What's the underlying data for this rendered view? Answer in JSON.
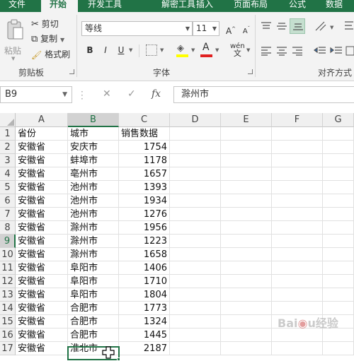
{
  "colors": {
    "accent": "#217346",
    "ribbon_bg": "#f3f3f3",
    "selection": "#217346"
  },
  "tabs": [
    {
      "label": "文件",
      "active": false
    },
    {
      "label": "开始",
      "active": true
    },
    {
      "label": "开发工具",
      "active": false
    },
    {
      "label": "解密工具",
      "active": false
    },
    {
      "label": "插入",
      "active": false
    },
    {
      "label": "页面布局",
      "active": false
    },
    {
      "label": "公式",
      "active": false
    },
    {
      "label": "数据",
      "active": false
    }
  ],
  "clipboard": {
    "paste_label": "粘贴",
    "cut_label": "剪切",
    "copy_label": "复制",
    "format_painter_label": "格式刷",
    "group_label": "剪贴板"
  },
  "font": {
    "font_name": "等线",
    "font_size": "11",
    "bold": "B",
    "italic": "I",
    "underline": "U",
    "phonetic": "wén",
    "group_label": "字体"
  },
  "alignment": {
    "group_label": "对齐方式"
  },
  "formula_bar": {
    "name_box": "B9",
    "cancel_icon": "✕",
    "enter_icon": "✓",
    "fx_label": "fx",
    "content": "滁州市"
  },
  "grid": {
    "columns": [
      "A",
      "B",
      "C",
      "D",
      "E",
      "F",
      "G"
    ],
    "selected_column": "B",
    "selected_row": "9",
    "rows": [
      {
        "num": "1",
        "a": "省份",
        "b": "城市",
        "c": "销售数据"
      },
      {
        "num": "2",
        "a": "安徽省",
        "b": "安庆市",
        "c": "1754"
      },
      {
        "num": "3",
        "a": "安徽省",
        "b": "蚌埠市",
        "c": "1178"
      },
      {
        "num": "4",
        "a": "安徽省",
        "b": "亳州市",
        "c": "1657"
      },
      {
        "num": "5",
        "a": "安徽省",
        "b": "池州市",
        "c": "1393"
      },
      {
        "num": "6",
        "a": "安徽省",
        "b": "池州市",
        "c": "1934"
      },
      {
        "num": "7",
        "a": "安徽省",
        "b": "池州市",
        "c": "1276"
      },
      {
        "num": "8",
        "a": "安徽省",
        "b": "滁州市",
        "c": "1956"
      },
      {
        "num": "9",
        "a": "安徽省",
        "b": "滁州市",
        "c": "1223"
      },
      {
        "num": "10",
        "a": "安徽省",
        "b": "滁州市",
        "c": "1658"
      },
      {
        "num": "11",
        "a": "安徽省",
        "b": "阜阳市",
        "c": "1406"
      },
      {
        "num": "12",
        "a": "安徽省",
        "b": "阜阳市",
        "c": "1710"
      },
      {
        "num": "13",
        "a": "安徽省",
        "b": "阜阳市",
        "c": "1804"
      },
      {
        "num": "14",
        "a": "安徽省",
        "b": "合肥市",
        "c": "1773"
      },
      {
        "num": "15",
        "a": "安徽省",
        "b": "合肥市",
        "c": "1324"
      },
      {
        "num": "16",
        "a": "安徽省",
        "b": "合肥市",
        "c": "1445"
      },
      {
        "num": "17",
        "a": "安徽省",
        "b": "淮北市",
        "c": "2187"
      }
    ]
  },
  "watermark": "Baidu经验"
}
